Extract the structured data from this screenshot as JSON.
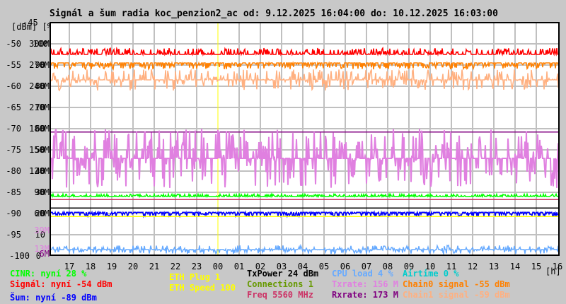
{
  "chart_data": {
    "type": "line",
    "title": "Signál a šum radia koc_penzion2_ac od: 9.12.2025 16:04:00 do: 10.12.2025 16:03:00",
    "ylabel": "[dBm] [%]",
    "xlabel": "[h]",
    "ylim_dbm": [
      -100,
      -45
    ],
    "ylim_pct": [
      0,
      110
    ],
    "ylim_mbit": [
      0,
      330
    ],
    "y_top_label": "-45",
    "y_ticks": [
      {
        "dbm": "-50",
        "pct": "100",
        "rate": "300M",
        "v": -50
      },
      {
        "dbm": "-55",
        "pct": "90",
        "rate": "270M",
        "v": -55
      },
      {
        "dbm": "-60",
        "pct": "80",
        "rate": "240M",
        "v": -60
      },
      {
        "dbm": "-65",
        "pct": "70",
        "rate": "210M",
        "v": -65
      },
      {
        "dbm": "-70",
        "pct": "60",
        "rate": "180M",
        "v": -70
      },
      {
        "dbm": "-75",
        "pct": "50",
        "rate": "150M",
        "v": -75
      },
      {
        "dbm": "-80",
        "pct": "40",
        "rate": "120M",
        "v": -80
      },
      {
        "dbm": "-85",
        "pct": "30",
        "rate": "90M",
        "v": -85
      },
      {
        "dbm": "-90",
        "pct": "20",
        "rate": "60M",
        "v": -90
      },
      {
        "dbm": "-95",
        "pct": "10",
        "rate": "",
        "v": -95
      },
      {
        "dbm": "-100",
        "pct": "0",
        "rate": "",
        "v": -100
      }
    ],
    "extra_rate_labels": [
      {
        "text": "39M",
        "color": "#e080e0",
        "v": -94
      },
      {
        "text": "13M",
        "color": "#e080e0",
        "v": -98.3
      },
      {
        "text": "6M",
        "color": "#800080",
        "v": -99.5
      }
    ],
    "x_ticks": [
      "17",
      "18",
      "19",
      "20",
      "21",
      "22",
      "23",
      "00",
      "01",
      "02",
      "03",
      "04",
      "05",
      "06",
      "07",
      "08",
      "09",
      "10",
      "11",
      "12",
      "13",
      "14",
      "15",
      "16"
    ],
    "grid": true,
    "series": [
      {
        "name": "Signál",
        "color": "#ff0000",
        "level": -52.5,
        "spread": 1.5,
        "dir": 1
      },
      {
        "name": "Chain0 signal",
        "color": "#ff8000",
        "level": -54.5,
        "spread": 1.5,
        "dir": -1
      },
      {
        "name": "Chain1 signal",
        "color": "#ffb080",
        "level": -58.5,
        "spread": 2.5,
        "dir": 0
      },
      {
        "name": "Rxrate",
        "color": "#800080",
        "level": -70.8,
        "spread": 0,
        "dir": 0
      },
      {
        "name": "Txrate",
        "color": "#e080e0",
        "level": -77,
        "spread": 7,
        "dir": 0
      },
      {
        "name": "CINR",
        "color": "#00ff00",
        "level": -86,
        "spread": 0.6,
        "dir": 1
      },
      {
        "name": "Freq",
        "color": "#cc3366",
        "level": -86.7,
        "spread": 0,
        "dir": 0
      },
      {
        "name": "ETH Plug",
        "color": "#000000",
        "level": -88.7,
        "spread": 0,
        "dir": 0
      },
      {
        "name": "Šum",
        "color": "#0000ff",
        "level": -89.7,
        "spread": 1,
        "dir": -1
      },
      {
        "name": "ETH Speed",
        "color": "#ffff00",
        "level": -90.7,
        "spread": 0,
        "dir": 0
      },
      {
        "name": "CPU load",
        "color": "#66aaff",
        "level": -98.5,
        "spread": 1,
        "dir": 0
      },
      {
        "name": "Connections",
        "color": "#669900",
        "level": -99.8,
        "spread": 0,
        "dir": 0
      }
    ]
  },
  "legend": {
    "cinr": "CINR: nyní 28 %",
    "signal": "Signál: nyní -54 dBm",
    "noise": "Šum: nyní -89 dBm",
    "eth_plug": "ETH Plug 1",
    "eth_speed": "ETH Speed 100",
    "txpower": "TxPower 24 dBm",
    "connections": "Connections 1",
    "freq": "Freq 5560 MHz",
    "cpu": "CPU load 4 %",
    "txrate": "Txrate: 156 M",
    "rxrate": "Rxrate: 173 M",
    "airtime": "Airtime 0 %",
    "chain0": "Chain0 signal -55 dBm",
    "chain1": "Chain1 signal -59 dBm"
  },
  "colors": {
    "cinr": "#00ff00",
    "signal": "#ff0000",
    "noise": "#0000ff",
    "eth": "#ffff00",
    "txpower": "#000000",
    "connections": "#669900",
    "freq": "#cc3366",
    "cpu": "#66aaff",
    "txrate": "#e080e0",
    "rxrate": "#800080",
    "airtime": "#00cccc",
    "chain0": "#ff8000",
    "chain1": "#ffb080"
  }
}
